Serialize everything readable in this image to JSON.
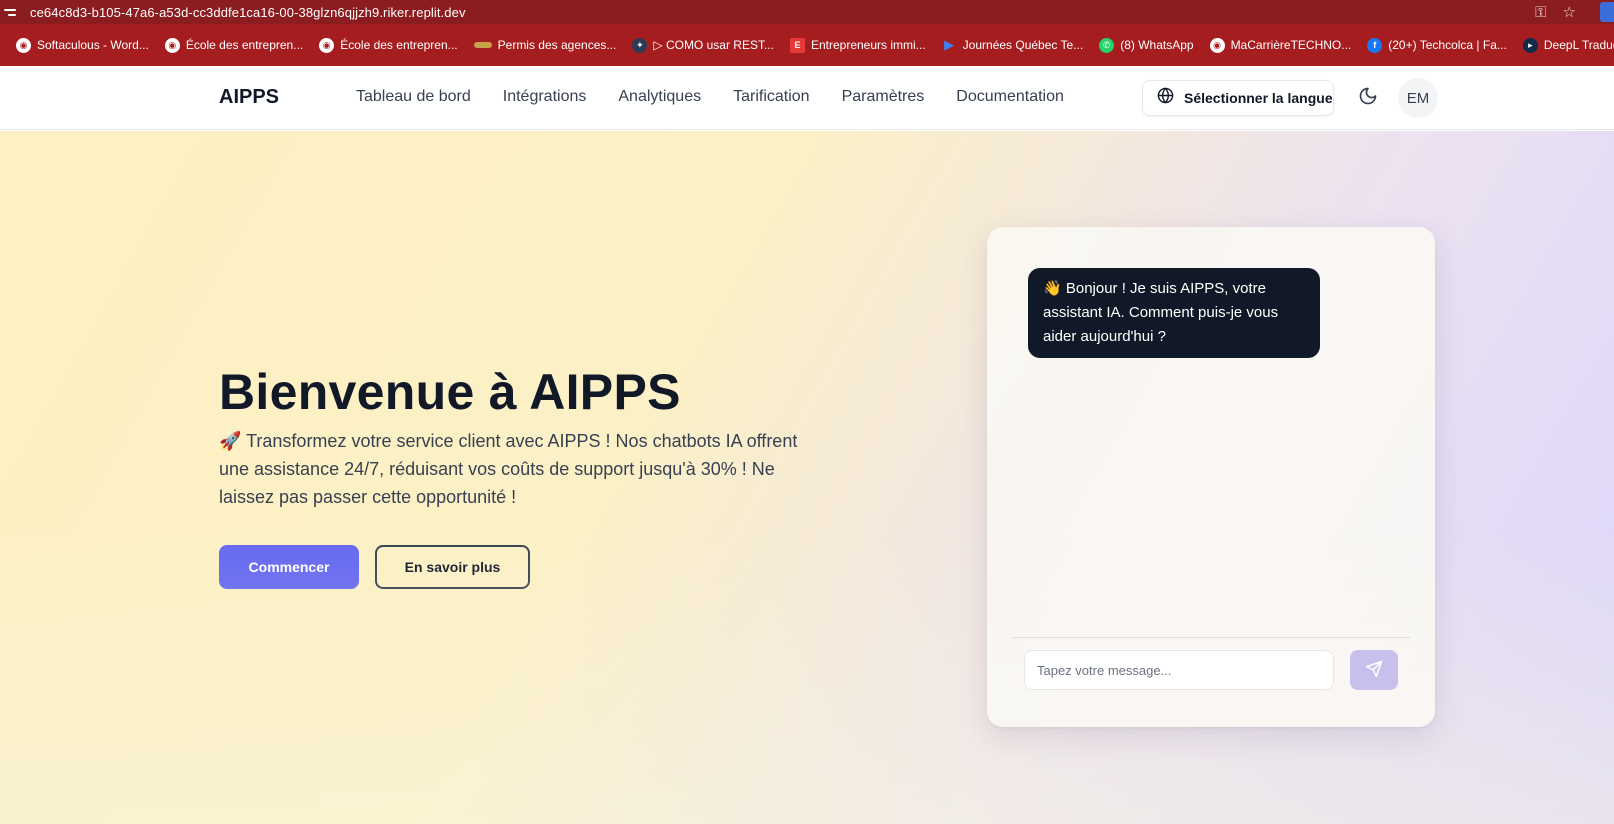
{
  "browser": {
    "url": "ce64c8d3-b105-47a6-a53d-cc3ddfe1ca16-00-38glzn6qjjzh9.riker.replit.dev",
    "bookmarks": [
      {
        "label": "Softaculous - Word...",
        "icon": "globe-icon"
      },
      {
        "label": "École des entrepren...",
        "icon": "globe-icon"
      },
      {
        "label": "École des entrepren...",
        "icon": "globe-icon"
      },
      {
        "label": "Permis des agences...",
        "icon": "bookmark-icon"
      },
      {
        "label": "▷ COMO usar REST...",
        "icon": "seal-icon"
      },
      {
        "label": "Entrepreneurs immi...",
        "icon": "e-icon"
      },
      {
        "label": "Journées Québec Te...",
        "icon": "play-icon"
      },
      {
        "label": "(8) WhatsApp",
        "icon": "whatsapp-icon"
      },
      {
        "label": "MaCarrièreTECHNO...",
        "icon": "globe-icon"
      },
      {
        "label": "(20+) Techcolca | Fa...",
        "icon": "facebook-icon"
      },
      {
        "label": "DeepL Traducti",
        "icon": "deepl-icon"
      }
    ]
  },
  "header": {
    "brand": "AIPPS",
    "nav": [
      "Tableau de bord",
      "Intégrations",
      "Analytiques",
      "Tarification",
      "Paramètres",
      "Documentation"
    ],
    "language_button": "Sélectionner la langue",
    "avatar_initials": "EM"
  },
  "hero": {
    "title": "Bienvenue à AIPPS",
    "subtitle": "🚀 Transformez votre service client avec AIPPS ! Nos chatbots IA offrent une assistance 24/7, réduisant vos coûts de support jusqu'à 30% ! Ne laissez pas passer cette opportunité !",
    "primary_button": "Commencer",
    "secondary_button": "En savoir plus"
  },
  "chat": {
    "greeting": "👋 Bonjour ! Je suis AIPPS, votre assistant IA. Comment puis-je vous aider aujourd'hui ?",
    "input_placeholder": "Tapez votre message...",
    "input_value": ""
  },
  "colors": {
    "primary": "#6366f1",
    "browser_bar": "#8b1c1f",
    "bookmarks_bar": "#a61d20",
    "dark_text": "#111827"
  }
}
